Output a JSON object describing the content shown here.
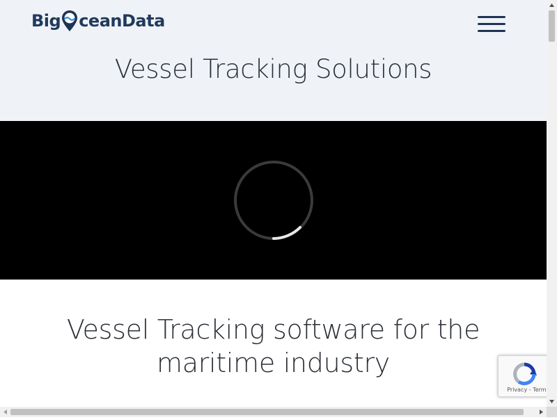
{
  "header": {
    "logo_text_left": "Big",
    "logo_text_right": "ceanData",
    "menu_icon": "hamburger-menu-icon",
    "hero_title": "Vessel Tracking Solutions"
  },
  "video": {
    "state": "loading",
    "spinner_icon": "loading-spinner-icon"
  },
  "main": {
    "section_title": "Vessel Tracking software for the maritime industry"
  },
  "recaptcha": {
    "privacy_label": "Privacy",
    "separator": " - ",
    "terms_label": "Terms",
    "icon": "recaptcha-icon"
  },
  "colors": {
    "header_bg": "#eff3f8",
    "brand_navy": "#203a5c",
    "brand_blue": "#2e8de0",
    "video_bg": "#000000",
    "text_dark": "#2a2f36"
  }
}
